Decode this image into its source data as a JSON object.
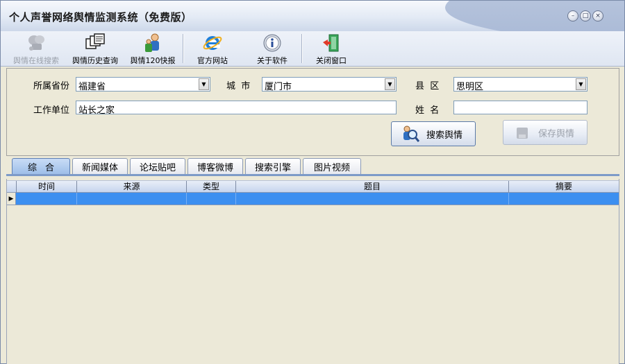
{
  "window": {
    "title": "个人声誉网络舆情监测系统（免费版）",
    "controls": {
      "minimize": "–",
      "maximize": "□",
      "close": "×"
    }
  },
  "toolbar": {
    "items": [
      {
        "label": "舆情在线搜索",
        "icon": "search-online-icon",
        "enabled": false
      },
      {
        "label": "舆情历史查询",
        "icon": "history-windows-icon",
        "enabled": true
      },
      {
        "label": "舆情120快报",
        "icon": "people-report-icon",
        "enabled": true
      },
      {
        "label": "官方网站",
        "icon": "internet-explorer-icon",
        "enabled": true
      },
      {
        "label": "关于软件",
        "icon": "info-icon",
        "enabled": true
      },
      {
        "label": "关闭窗口",
        "icon": "exit-door-icon",
        "enabled": true
      }
    ]
  },
  "form": {
    "province_label": "所属省份",
    "province_value": "福建省",
    "city_label": "城  市",
    "city_value": "厦门市",
    "county_label": "县  区",
    "county_value": "思明区",
    "org_label": "工作单位",
    "org_value": "站长之家",
    "name_label": "姓  名",
    "name_value": "",
    "search_button": "搜索舆情",
    "save_button": "保存舆情"
  },
  "tabs": [
    {
      "label": "综合",
      "active": true
    },
    {
      "label": "新闻媒体",
      "active": false
    },
    {
      "label": "论坛贴吧",
      "active": false
    },
    {
      "label": "博客微博",
      "active": false
    },
    {
      "label": "搜索引擎",
      "active": false
    },
    {
      "label": "图片视频",
      "active": false
    }
  ],
  "grid": {
    "columns": [
      "时间",
      "来源",
      "类型",
      "题目",
      "摘要"
    ],
    "row_indicator": "▶"
  },
  "colors": {
    "selection": "#3c8ff0",
    "active_tab": "#9cbde8"
  }
}
